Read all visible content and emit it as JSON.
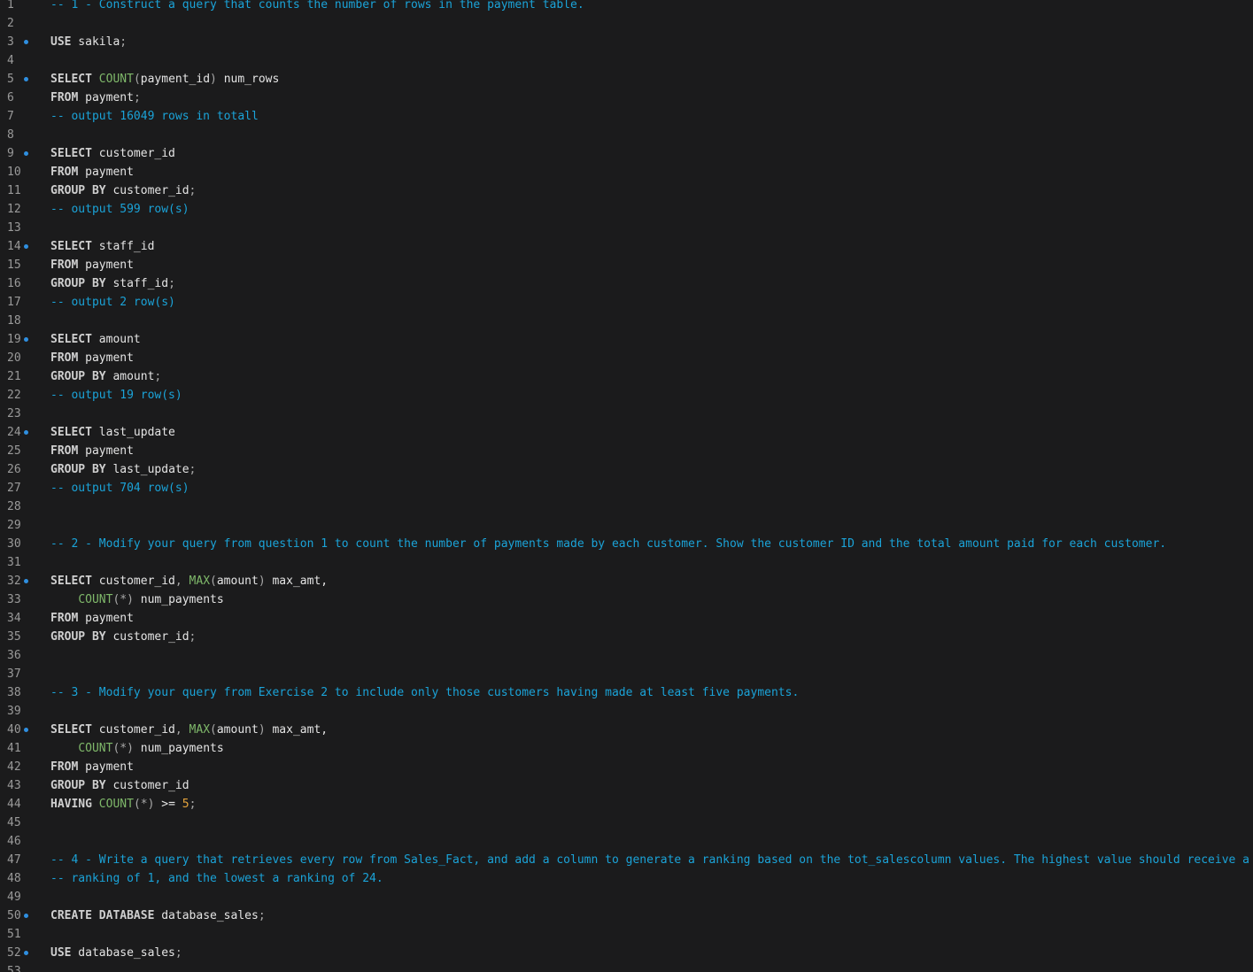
{
  "editor": {
    "lines": [
      {
        "n": "1",
        "marker": false,
        "tokens": [
          {
            "t": "-- 1 - Construct a query that counts the number of rows in the payment table.",
            "c": "cm"
          }
        ]
      },
      {
        "n": "2",
        "marker": false,
        "tokens": []
      },
      {
        "n": "3",
        "marker": true,
        "tokens": [
          {
            "t": "USE",
            "c": "kw"
          },
          {
            "t": " sakila",
            "c": "id"
          },
          {
            "t": ";",
            "c": "op"
          }
        ]
      },
      {
        "n": "4",
        "marker": false,
        "tokens": []
      },
      {
        "n": "5",
        "marker": true,
        "tokens": [
          {
            "t": "SELECT",
            "c": "kw"
          },
          {
            "t": " ",
            "c": "id"
          },
          {
            "t": "COUNT",
            "c": "fn"
          },
          {
            "t": "(",
            "c": "op"
          },
          {
            "t": "payment_id",
            "c": "id"
          },
          {
            "t": ")",
            "c": "op"
          },
          {
            "t": " num_rows",
            "c": "id"
          }
        ]
      },
      {
        "n": "6",
        "marker": false,
        "tokens": [
          {
            "t": "FROM",
            "c": "kw"
          },
          {
            "t": " payment",
            "c": "id"
          },
          {
            "t": ";",
            "c": "op"
          }
        ]
      },
      {
        "n": "7",
        "marker": false,
        "tokens": [
          {
            "t": "-- output 16049 rows in totall",
            "c": "cm"
          }
        ]
      },
      {
        "n": "8",
        "marker": false,
        "tokens": []
      },
      {
        "n": "9",
        "marker": true,
        "tokens": [
          {
            "t": "SELECT",
            "c": "kw"
          },
          {
            "t": " customer_id",
            "c": "id"
          }
        ]
      },
      {
        "n": "10",
        "marker": false,
        "tokens": [
          {
            "t": "FROM",
            "c": "kw"
          },
          {
            "t": " payment",
            "c": "id"
          }
        ]
      },
      {
        "n": "11",
        "marker": false,
        "tokens": [
          {
            "t": "GROUP BY",
            "c": "kw"
          },
          {
            "t": " customer_id",
            "c": "id"
          },
          {
            "t": ";",
            "c": "op"
          }
        ]
      },
      {
        "n": "12",
        "marker": false,
        "tokens": [
          {
            "t": "-- output 599 row(s)",
            "c": "cm"
          }
        ]
      },
      {
        "n": "13",
        "marker": false,
        "tokens": []
      },
      {
        "n": "14",
        "marker": true,
        "tokens": [
          {
            "t": "SELECT",
            "c": "kw"
          },
          {
            "t": " staff_id",
            "c": "id"
          }
        ]
      },
      {
        "n": "15",
        "marker": false,
        "tokens": [
          {
            "t": "FROM",
            "c": "kw"
          },
          {
            "t": " payment",
            "c": "id"
          }
        ]
      },
      {
        "n": "16",
        "marker": false,
        "tokens": [
          {
            "t": "GROUP BY",
            "c": "kw"
          },
          {
            "t": " staff_id",
            "c": "id"
          },
          {
            "t": ";",
            "c": "op"
          }
        ]
      },
      {
        "n": "17",
        "marker": false,
        "tokens": [
          {
            "t": "-- output 2 row(s)",
            "c": "cm"
          }
        ]
      },
      {
        "n": "18",
        "marker": false,
        "tokens": []
      },
      {
        "n": "19",
        "marker": true,
        "tokens": [
          {
            "t": "SELECT",
            "c": "kw"
          },
          {
            "t": " amount",
            "c": "id"
          }
        ]
      },
      {
        "n": "20",
        "marker": false,
        "tokens": [
          {
            "t": "FROM",
            "c": "kw"
          },
          {
            "t": " payment",
            "c": "id"
          }
        ]
      },
      {
        "n": "21",
        "marker": false,
        "tokens": [
          {
            "t": "GROUP BY",
            "c": "kw"
          },
          {
            "t": " amount",
            "c": "id"
          },
          {
            "t": ";",
            "c": "op"
          }
        ]
      },
      {
        "n": "22",
        "marker": false,
        "tokens": [
          {
            "t": "-- output 19 row(s)",
            "c": "cm"
          }
        ]
      },
      {
        "n": "23",
        "marker": false,
        "tokens": []
      },
      {
        "n": "24",
        "marker": true,
        "tokens": [
          {
            "t": "SELECT",
            "c": "kw"
          },
          {
            "t": " last_update",
            "c": "id"
          }
        ]
      },
      {
        "n": "25",
        "marker": false,
        "tokens": [
          {
            "t": "FROM",
            "c": "kw"
          },
          {
            "t": " payment",
            "c": "id"
          }
        ]
      },
      {
        "n": "26",
        "marker": false,
        "tokens": [
          {
            "t": "GROUP BY",
            "c": "kw"
          },
          {
            "t": " last_update",
            "c": "id"
          },
          {
            "t": ";",
            "c": "op"
          }
        ]
      },
      {
        "n": "27",
        "marker": false,
        "tokens": [
          {
            "t": "-- output 704 row(s)",
            "c": "cm"
          }
        ]
      },
      {
        "n": "28",
        "marker": false,
        "tokens": []
      },
      {
        "n": "29",
        "marker": false,
        "tokens": []
      },
      {
        "n": "30",
        "marker": false,
        "tokens": [
          {
            "t": "-- 2 - Modify your query from question 1 to count the number of payments made by each customer. Show the customer ID and the total amount paid for each customer.",
            "c": "cm"
          }
        ]
      },
      {
        "n": "31",
        "marker": false,
        "tokens": []
      },
      {
        "n": "32",
        "marker": true,
        "tokens": [
          {
            "t": "SELECT",
            "c": "kw"
          },
          {
            "t": " customer_id",
            "c": "id"
          },
          {
            "t": ",",
            "c": "op"
          },
          {
            "t": " ",
            "c": "id"
          },
          {
            "t": "MAX",
            "c": "fn"
          },
          {
            "t": "(",
            "c": "op"
          },
          {
            "t": "amount",
            "c": "id"
          },
          {
            "t": ")",
            "c": "op"
          },
          {
            "t": " max_amt,",
            "c": "id"
          }
        ]
      },
      {
        "n": "33",
        "marker": false,
        "tokens": [
          {
            "t": "    ",
            "c": "id"
          },
          {
            "t": "COUNT",
            "c": "fn"
          },
          {
            "t": "(*)",
            "c": "op"
          },
          {
            "t": " num_payments",
            "c": "id"
          }
        ]
      },
      {
        "n": "34",
        "marker": false,
        "tokens": [
          {
            "t": "FROM",
            "c": "kw"
          },
          {
            "t": " payment",
            "c": "id"
          }
        ]
      },
      {
        "n": "35",
        "marker": false,
        "tokens": [
          {
            "t": "GROUP BY",
            "c": "kw"
          },
          {
            "t": " customer_id",
            "c": "id"
          },
          {
            "t": ";",
            "c": "op"
          }
        ]
      },
      {
        "n": "36",
        "marker": false,
        "tokens": []
      },
      {
        "n": "37",
        "marker": false,
        "tokens": []
      },
      {
        "n": "38",
        "marker": false,
        "tokens": [
          {
            "t": "-- 3 - Modify your query from Exercise 2 to include only those customers having made at least five payments.",
            "c": "cm"
          }
        ]
      },
      {
        "n": "39",
        "marker": false,
        "tokens": []
      },
      {
        "n": "40",
        "marker": true,
        "tokens": [
          {
            "t": "SELECT",
            "c": "kw"
          },
          {
            "t": " customer_id",
            "c": "id"
          },
          {
            "t": ",",
            "c": "op"
          },
          {
            "t": " ",
            "c": "id"
          },
          {
            "t": "MAX",
            "c": "fn"
          },
          {
            "t": "(",
            "c": "op"
          },
          {
            "t": "amount",
            "c": "id"
          },
          {
            "t": ")",
            "c": "op"
          },
          {
            "t": " max_amt,",
            "c": "id"
          }
        ]
      },
      {
        "n": "41",
        "marker": false,
        "tokens": [
          {
            "t": "    ",
            "c": "id"
          },
          {
            "t": "COUNT",
            "c": "fn"
          },
          {
            "t": "(*)",
            "c": "op"
          },
          {
            "t": " num_payments",
            "c": "id"
          }
        ]
      },
      {
        "n": "42",
        "marker": false,
        "tokens": [
          {
            "t": "FROM",
            "c": "kw"
          },
          {
            "t": " payment",
            "c": "id"
          }
        ]
      },
      {
        "n": "43",
        "marker": false,
        "tokens": [
          {
            "t": "GROUP BY",
            "c": "kw"
          },
          {
            "t": " customer_id",
            "c": "id"
          }
        ]
      },
      {
        "n": "44",
        "marker": false,
        "tokens": [
          {
            "t": "HAVING",
            "c": "kw"
          },
          {
            "t": " ",
            "c": "id"
          },
          {
            "t": "COUNT",
            "c": "fn"
          },
          {
            "t": "(*)",
            "c": "op"
          },
          {
            "t": " >= ",
            "c": "id"
          },
          {
            "t": "5",
            "c": "num"
          },
          {
            "t": ";",
            "c": "op"
          }
        ]
      },
      {
        "n": "45",
        "marker": false,
        "tokens": []
      },
      {
        "n": "46",
        "marker": false,
        "tokens": []
      },
      {
        "n": "47",
        "marker": false,
        "tokens": [
          {
            "t": "-- 4 - Write a query that retrieves every row from Sales_Fact, and add a column to generate a ranking based on the tot_salescolumn values. The highest value should receive a",
            "c": "cm"
          }
        ]
      },
      {
        "n": "48",
        "marker": false,
        "tokens": [
          {
            "t": "-- ranking of 1, and the lowest a ranking of 24.",
            "c": "cm"
          }
        ]
      },
      {
        "n": "49",
        "marker": false,
        "tokens": []
      },
      {
        "n": "50",
        "marker": true,
        "tokens": [
          {
            "t": "CREATE DATABASE",
            "c": "kw"
          },
          {
            "t": " database_sales",
            "c": "id"
          },
          {
            "t": ";",
            "c": "op"
          }
        ]
      },
      {
        "n": "51",
        "marker": false,
        "tokens": []
      },
      {
        "n": "52",
        "marker": true,
        "tokens": [
          {
            "t": "USE",
            "c": "kw"
          },
          {
            "t": " database_sales",
            "c": "id"
          },
          {
            "t": ";",
            "c": "op"
          }
        ]
      },
      {
        "n": "53",
        "marker": false,
        "tokens": []
      }
    ]
  }
}
